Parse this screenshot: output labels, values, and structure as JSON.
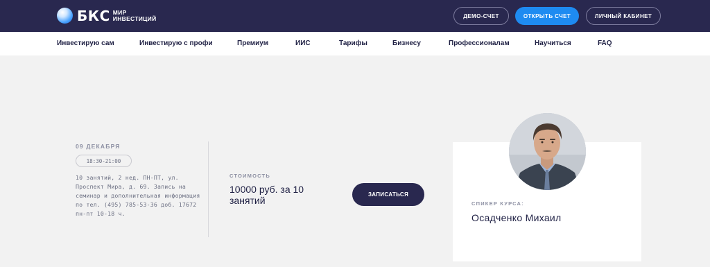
{
  "header": {
    "logo": {
      "brand": "БКС",
      "sub_line1": "МИР",
      "sub_line2": "ИНВЕСТИЦИЙ"
    },
    "buttons": {
      "demo": "ДЕМО-СЧЕТ",
      "open_account": "ОТКРЫТЬ СЧЕТ",
      "cabinet": "ЛИЧНЫЙ КАБИНЕТ"
    }
  },
  "nav": {
    "items": [
      {
        "label": "Инвестирую сам"
      },
      {
        "label": "Инвестирую с профи"
      },
      {
        "label": "Премиум"
      },
      {
        "label": "ИИС"
      },
      {
        "label": "Тарифы"
      },
      {
        "label": "Бизнесу"
      },
      {
        "label": "Профессионалам"
      },
      {
        "label": "Научиться"
      },
      {
        "label": "FAQ"
      }
    ]
  },
  "event": {
    "date": "09 ДЕКАБРЯ",
    "time": "18:30-21:00",
    "description": "10 занятий, 2 нед. ПН-ПТ, ул. Проспект Мира, д. 69. Запись на семинар и дополнительная информация по тел. (495) 785-53-36 доб. 17672 пн-пт 10-18 ч.",
    "price_label": "СТОИМОСТЬ",
    "price_value": "10000 руб. за 10 занятий",
    "enroll_button": "ЗАПИСАТЬСЯ"
  },
  "speaker": {
    "label": "СПИКЕР КУРСА:",
    "name": "Осадченко Михаил"
  },
  "colors": {
    "header_bg": "#29284f",
    "primary_button": "#1e8bf1",
    "page_bg": "#f2f2f2",
    "text_dark": "#1f2044",
    "text_muted": "#8c8fa2"
  }
}
